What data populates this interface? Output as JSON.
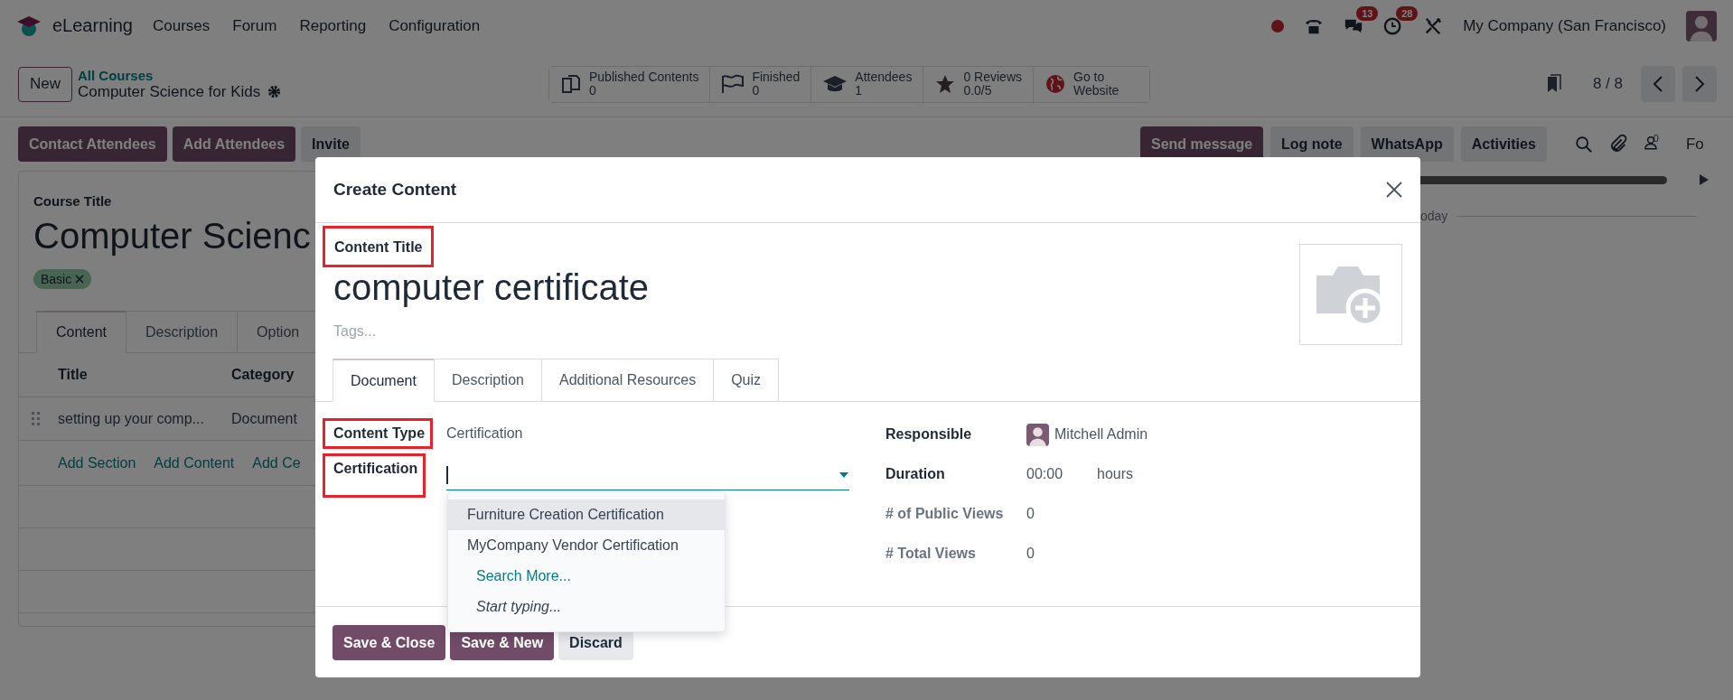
{
  "navbar": {
    "app": "eLearning",
    "menu": [
      "Courses",
      "Forum",
      "Reporting",
      "Configuration"
    ],
    "messages_badge": "13",
    "activities_badge": "28",
    "company": "My Company (San Francisco)"
  },
  "control_panel": {
    "new_button": "New",
    "breadcrumb": "All Courses",
    "record": "Computer Science for Kids",
    "stats": [
      {
        "label": "Published Contents",
        "value": "0"
      },
      {
        "label": "Finished",
        "value": "0"
      },
      {
        "label": "Attendees",
        "value": "1"
      },
      {
        "label": "0 Reviews",
        "value": "0.0/5"
      },
      {
        "label": "Go to",
        "value": "Website"
      }
    ],
    "pager": "8 / 8"
  },
  "actions": [
    "Contact Attendees",
    "Add Attendees",
    "Invite"
  ],
  "chatter": {
    "buttons": [
      {
        "label": "Send message",
        "primary": true
      },
      {
        "label": "Log note",
        "primary": false
      },
      {
        "label": "WhatsApp",
        "primary": false
      },
      {
        "label": "Activities",
        "primary": false
      }
    ],
    "followers": "0",
    "cut_label": "Fo",
    "player": {
      "level": 1
    },
    "divider": "oday"
  },
  "sheet": {
    "label": "Course Title",
    "title": "Computer Scienc",
    "tags": [
      "Basic"
    ],
    "tabs": [
      {
        "label": "Content",
        "selected": true
      },
      {
        "label": "Description",
        "selected": false
      },
      {
        "label": "Option",
        "selected": false
      }
    ],
    "columns": [
      "Title",
      "Category"
    ],
    "rows": [
      [
        "setting up your comp...",
        "Document"
      ]
    ],
    "add_links": [
      "Add Section",
      "Add Content",
      "Add Ce"
    ]
  },
  "dialog": {
    "title": "Create Content",
    "title_label": {
      "text": "Content Title",
      "highlighted": true
    },
    "name": "computer certificate",
    "tags_placeholder": "Tags...",
    "tabs": [
      {
        "label": "Document",
        "selected": true
      },
      {
        "label": "Description",
        "selected": false
      },
      {
        "label": "Additional Resources",
        "selected": false
      },
      {
        "label": "Quiz",
        "selected": false
      }
    ],
    "left_fields": [
      {
        "kind": "text",
        "label": "Content Type",
        "value": "Certification",
        "highlighted": true
      },
      {
        "kind": "select",
        "label": "Certification",
        "highlighted": true
      }
    ],
    "right_fields": [
      {
        "kind": "user",
        "label": "Responsible",
        "value": "Mitchell Admin",
        "readonly": false
      },
      {
        "kind": "duration",
        "label": "Duration",
        "value": "00:00",
        "unit": "hours",
        "readonly": false
      },
      {
        "kind": "text",
        "label": "# of Public Views",
        "value": "0",
        "readonly": true
      },
      {
        "kind": "text",
        "label": "# Total Views",
        "value": "0",
        "readonly": true
      }
    ],
    "dropdown": {
      "options": [
        {
          "label": "Furniture Creation Certification",
          "selected": true
        },
        {
          "label": "MyCompany Vendor Certification",
          "selected": false
        }
      ],
      "search_more": "Search More...",
      "hint": "Start typing..."
    },
    "buttons": [
      {
        "label": "Save & Close",
        "kind": "primary"
      },
      {
        "label": "Save & New",
        "kind": "primary"
      },
      {
        "label": "Discard",
        "kind": "secondary"
      }
    ]
  }
}
